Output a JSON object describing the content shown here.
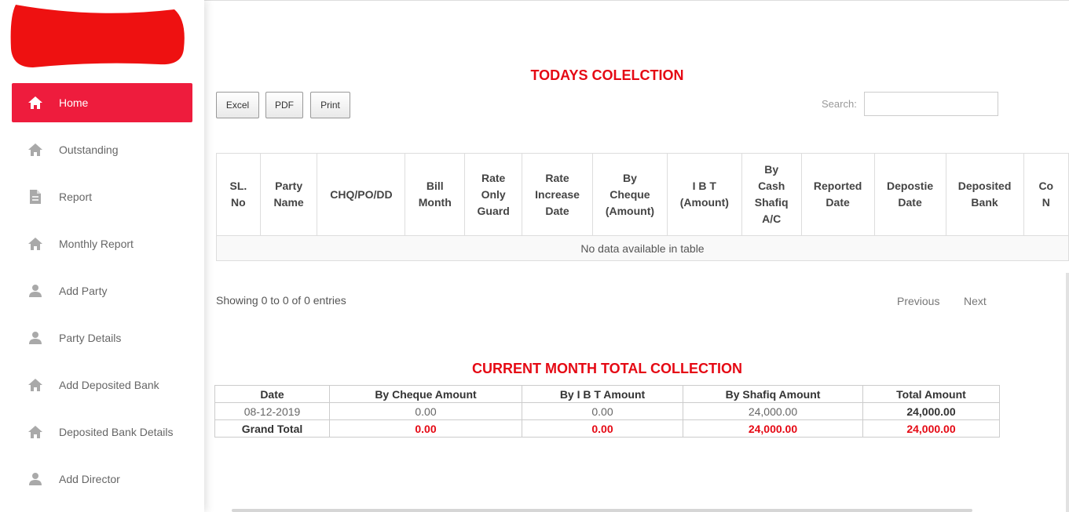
{
  "sidebar": {
    "items": [
      {
        "label": "Home",
        "icon": "home-icon",
        "active": true
      },
      {
        "label": "Outstanding",
        "icon": "home-icon"
      },
      {
        "label": "Report",
        "icon": "document-icon"
      },
      {
        "label": "Monthly Report",
        "icon": "home-icon"
      },
      {
        "label": "Add Party",
        "icon": "user-icon"
      },
      {
        "label": "Party Details",
        "icon": "user-icon"
      },
      {
        "label": "Add Deposited Bank",
        "icon": "home-icon"
      },
      {
        "label": "Deposited Bank Details",
        "icon": "home-icon"
      },
      {
        "label": "Add Director",
        "icon": "user-icon"
      }
    ]
  },
  "todays": {
    "title": "TODAYS COLELCTION",
    "buttons": {
      "excel": "Excel",
      "pdf": "PDF",
      "print": "Print"
    },
    "search_label": "Search:",
    "search_value": "",
    "columns": [
      [
        "SL.",
        "No"
      ],
      [
        "Party",
        "Name"
      ],
      [
        "CHQ/PO/DD"
      ],
      [
        "Bill",
        "Month"
      ],
      [
        "Rate",
        "Only",
        "Guard"
      ],
      [
        "Rate",
        "Increase",
        "Date"
      ],
      [
        "By",
        "Cheque",
        "(Amount)"
      ],
      [
        "I B T",
        "(Amount)"
      ],
      [
        "By",
        "Cash",
        "Shafiq",
        "A/C"
      ],
      [
        "Reported",
        "Date"
      ],
      [
        "Depostie",
        "Date"
      ],
      [
        "Deposited",
        "Bank"
      ],
      [
        "Co",
        "N"
      ]
    ],
    "empty_message": "No data available in table",
    "info": "Showing 0 to 0 of 0 entries",
    "previous": "Previous",
    "next": "Next"
  },
  "current_month": {
    "title": "CURRENT MONTH TOTAL COLLECTION",
    "headers": [
      "Date",
      "By Cheque Amount",
      "By I B T Amount",
      "By Shafiq Amount",
      "Total Amount"
    ],
    "rows": [
      [
        "08-12-2019",
        "0.00",
        "0.00",
        "24,000.00",
        "24,000.00"
      ]
    ],
    "grand_total": [
      "Grand Total",
      "0.00",
      "0.00",
      "24,000.00",
      "24,000.00"
    ]
  },
  "colors": {
    "accent": "#ee1c3d",
    "title_red": "#e50914",
    "logo_red": "#ff0000"
  }
}
